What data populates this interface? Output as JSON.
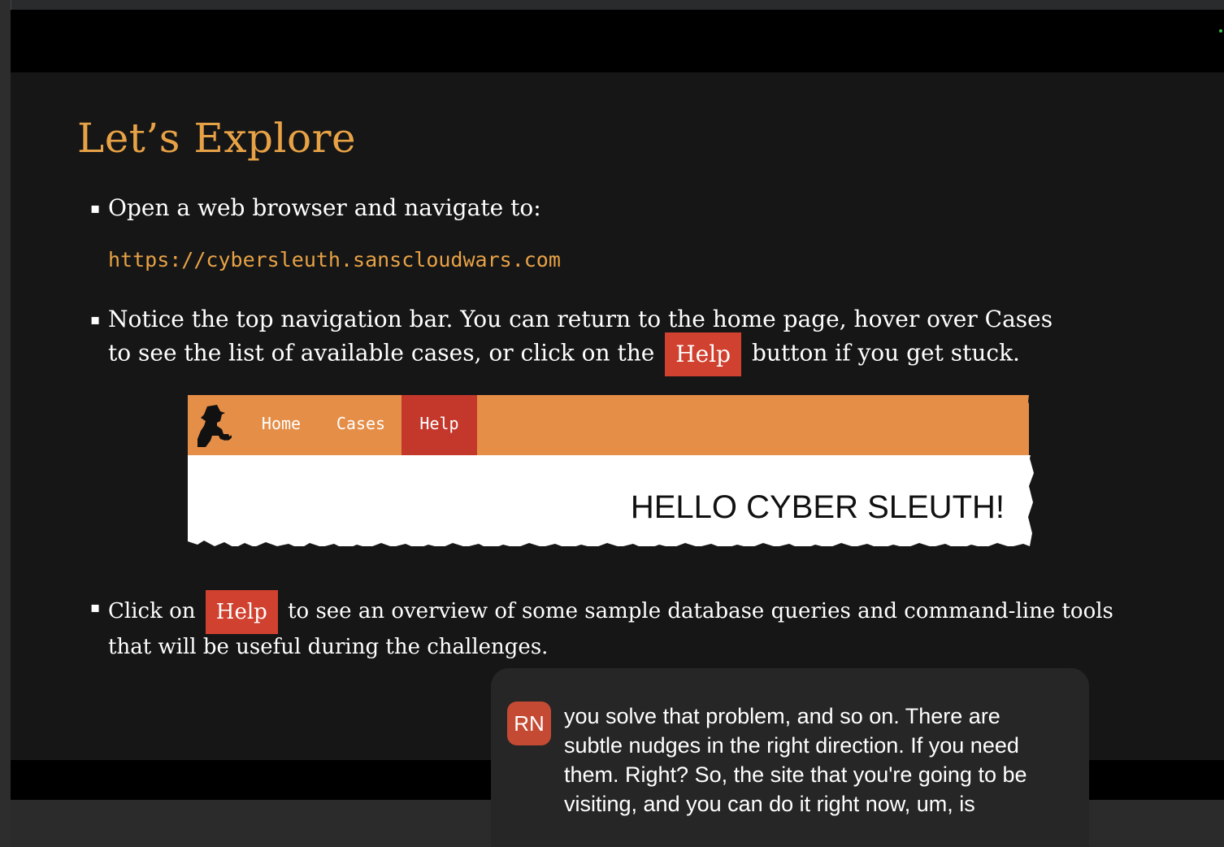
{
  "slide": {
    "title": "Let’s Explore",
    "bullets": [
      {
        "lines": [
          "Open a web browser and navigate to:"
        ]
      },
      {
        "line1": "Notice the top navigation bar. You can return to the home page, hover over Cases",
        "line2_before": "to see the list of available cases, or click on the",
        "line2_after": "button if you get stuck."
      },
      {
        "line1_before": "Click on",
        "line1_after": "to see an overview of some sample database queries and command-line tools",
        "line2": "that will be useful during the challenges."
      }
    ],
    "url": "https://cybersleuth.sanscloudwars.com",
    "help_label": "Help",
    "bullet_glyph": "▪"
  },
  "embedded_site": {
    "nav": [
      "Home",
      "Cases",
      "Help"
    ],
    "heading": "HELLO CYBER SLEUTH!",
    "colors": {
      "nav_bg": "#e58e48",
      "help_bg": "#c4382c"
    }
  },
  "caption": {
    "speaker_initials": "RN",
    "lines": [
      "you solve that problem, and so on. There are",
      "subtle nudges in the right direction. If you need",
      "them. Right? So, the site that you're going to be",
      "visiting, and you can do it right now, um, is"
    ]
  },
  "colors": {
    "accent": "#e8a246",
    "help_red": "#d14130",
    "slide_bg": "#161616",
    "avatar_bg": "#c44a34"
  }
}
